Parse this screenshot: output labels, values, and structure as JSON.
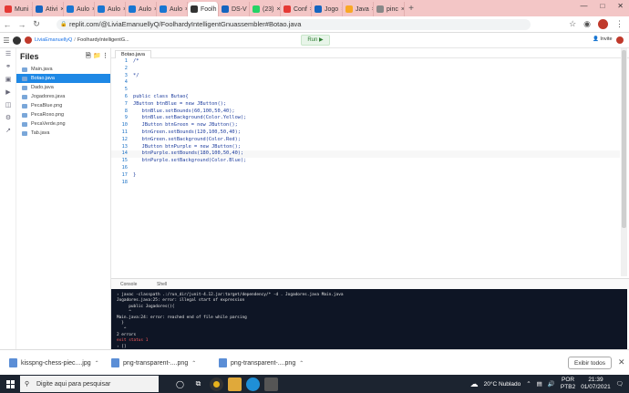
{
  "browser_tabs": [
    {
      "label": "Muni",
      "color": "#e53935"
    },
    {
      "label": "Ativi",
      "color": "#1565c0"
    },
    {
      "label": "Aulo",
      "color": "#1976d2"
    },
    {
      "label": "Aulo",
      "color": "#1976d2"
    },
    {
      "label": "Aulo",
      "color": "#1976d2"
    },
    {
      "label": "Aulo",
      "color": "#1976d2"
    },
    {
      "label": "Foolh",
      "color": "#333333"
    },
    {
      "label": "DS-V",
      "color": "#1565c0"
    },
    {
      "label": "(23)",
      "color": "#25d366"
    },
    {
      "label": "Conf",
      "color": "#e53935"
    },
    {
      "label": "Jogo",
      "color": "#1565c0"
    },
    {
      "label": "Java",
      "color": "#f9a825"
    },
    {
      "label": "pinc",
      "color": "#888888"
    }
  ],
  "address": {
    "url": "replit.com/@LiviaEmanuellyQ/FoolhardyIntelligentGnuassembler#Botao.java"
  },
  "replit": {
    "user": "LiviaEmanuellyQ",
    "repl": "FoolhardyIntelligentG...",
    "run_label": "Run ▶",
    "invite_label": "Invite"
  },
  "files": {
    "title": "Files",
    "items": [
      "Main.java",
      "Botao.java",
      "Dado.java",
      "Jogadores.java",
      "PecaBlue.png",
      "PecaRoxo.png",
      "PecaVerde.png",
      "Tab.java"
    ]
  },
  "editor": {
    "tab": "Botao.java",
    "lines": [
      {
        "n": "1",
        "t": "/*"
      },
      {
        "n": "2",
        "t": ""
      },
      {
        "n": "3",
        "t": "*/"
      },
      {
        "n": "4",
        "t": ""
      },
      {
        "n": "5",
        "t": ""
      },
      {
        "n": "6",
        "t": "public class Butao{"
      },
      {
        "n": "7",
        "t": "JButton btnBlue = new JButton();"
      },
      {
        "n": "8",
        "t": "   btnBlue.setBounds(60,100,50,40);"
      },
      {
        "n": "9",
        "t": "   btnBlue.setBackground(Color.Yellow);"
      },
      {
        "n": "10",
        "t": "   JButton btnGreen = new JButton();"
      },
      {
        "n": "11",
        "t": "   btnGreen.setBounds(120,100,50,40);"
      },
      {
        "n": "12",
        "t": "   btnGreen.setBackground(Color.Red);"
      },
      {
        "n": "13",
        "t": "   JButton btnPurple = new JButton();"
      },
      {
        "n": "14",
        "t": "   btnPurple.setBounds(180,100,50,40);"
      },
      {
        "n": "15",
        "t": "   btnPurple.setBackground(Color.Blue);"
      },
      {
        "n": "16",
        "t": ""
      },
      {
        "n": "17",
        "t": "}"
      },
      {
        "n": "18",
        "t": ""
      }
    ]
  },
  "bottom_tabs": [
    "Console",
    "Shell"
  ],
  "console": {
    "lines": [
      {
        "t": "› javac -classpath .:/run_dir/junit-4.12.jar:target/dependency/* -d . Jogadores.java Main.java",
        "c": ""
      },
      {
        "t": "Jogadores.java:25: error: illegal start of expression",
        "c": ""
      },
      {
        "t": "     public Jogadores(){",
        "c": ""
      },
      {
        "t": "     ^",
        "c": ""
      },
      {
        "t": "Main.java:24: error: reached end of file while parsing",
        "c": ""
      },
      {
        "t": "  }",
        "c": ""
      },
      {
        "t": "   ^",
        "c": ""
      },
      {
        "t": "2 errors",
        "c": ""
      },
      {
        "t": "exit status 1",
        "c": "red"
      },
      {
        "t": "› []",
        "c": ""
      }
    ]
  },
  "downloads": {
    "items": [
      "kisspng-chess-piec....jpg",
      "png-transparent-....png",
      "png-transparent-....png"
    ],
    "show_all": "Exibir todos"
  },
  "taskbar": {
    "search_placeholder": "Digite aqui para pesquisar",
    "weather": "20°C  Nublado",
    "lang": "POR",
    "lang2": "PTB2",
    "time": "21:39",
    "date": "01/07/2021"
  }
}
